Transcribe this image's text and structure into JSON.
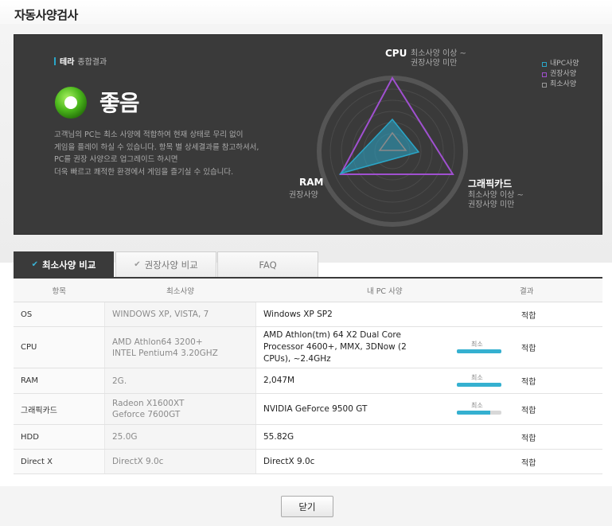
{
  "page": {
    "title": "자동사양검사"
  },
  "summary": {
    "label_brand": "테라",
    "label_text": "종합결과",
    "status": "좋음",
    "description": [
      "고객님의 PC는 최소 사양에 적합하여 현재 상태로 무리 없이",
      "게임을 플레이 하실 수 있습니다. 항목 별 상세결과를 참고하셔서,",
      "PC를 권장 사양으로 업그레이드 하시면",
      "더욱 빠르고 쾌적한 환경에서 게임을 즐기실 수 있습니다."
    ]
  },
  "radar": {
    "cpu_label": "CPU",
    "cpu_sub": [
      "최소사양 이상 ~",
      "권장사양 미만"
    ],
    "ram_label": "RAM",
    "ram_sub": "권장사양",
    "gpu_label": "그래픽카드",
    "gpu_sub": [
      "최소사양 이상 ~",
      "권장사양 미만"
    ],
    "legend": [
      {
        "label": "내PC사양",
        "color": "#2aa6c8"
      },
      {
        "label": "권장사양",
        "color": "#a050d0"
      },
      {
        "label": "최소사양",
        "color": "#999999"
      }
    ]
  },
  "tabs": [
    {
      "label": "최소사양 비교",
      "active": true
    },
    {
      "label": "권장사양 비교",
      "active": false
    },
    {
      "label": "FAQ",
      "active": false
    }
  ],
  "table": {
    "headers": [
      "항목",
      "최소사양",
      "내 PC 사양",
      "결과"
    ],
    "rows": [
      {
        "item": "OS",
        "min": [
          "WINDOWS XP, VISTA, 7"
        ],
        "my": [
          "Windows XP SP2"
        ],
        "gauge": null,
        "result": "적합"
      },
      {
        "item": "CPU",
        "min": [
          "AMD Athlon64 3200+",
          "INTEL Pentium4 3.20GHZ"
        ],
        "my": [
          "AMD Athlon(tm) 64 X2 Dual Core",
          "Processor 4600+, MMX, 3DNow (2",
          "CPUs), ~2.4GHz"
        ],
        "gauge": {
          "label": "최소",
          "fill": 1.0
        },
        "result": "적합"
      },
      {
        "item": "RAM",
        "min": [
          "2G."
        ],
        "my": [
          "2,047M"
        ],
        "gauge": {
          "label": "최소",
          "fill": 1.0
        },
        "result": "적합"
      },
      {
        "item": "그래픽카드",
        "min": [
          "Radeon X1600XT",
          "Geforce 7600GT"
        ],
        "my": [
          "NVIDIA GeForce 9500 GT"
        ],
        "gauge": {
          "label": "최소",
          "fill": 0.75
        },
        "result": "적합"
      },
      {
        "item": "HDD",
        "min": [
          "25.0G"
        ],
        "my": [
          "55.82G"
        ],
        "gauge": null,
        "result": "적합"
      },
      {
        "item": "Direct X",
        "min": [
          "DirectX 9.0c"
        ],
        "my": [
          "DirectX 9.0c"
        ],
        "gauge": null,
        "result": "적합"
      }
    ]
  },
  "close_button": "닫기"
}
